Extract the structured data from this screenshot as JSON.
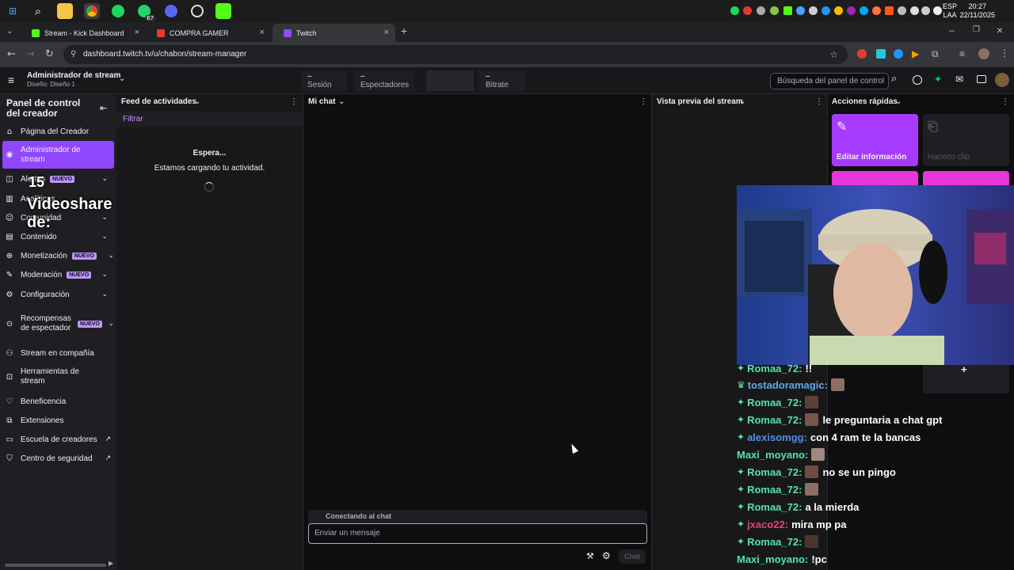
{
  "browser": {
    "tabs": [
      {
        "label": "Stream - Kick Dashboard",
        "favicon_color": "#53fc18"
      },
      {
        "label": "COMPRA GAMER",
        "favicon_color": "#e53935"
      },
      {
        "label": "Twitch",
        "favicon_color": "#9147ff"
      }
    ],
    "url": "dashboard.twitch.tv/u/chabon/stream-manager",
    "new_tab_glyph": "+"
  },
  "system": {
    "lang_line1": "ESP",
    "lang_line2": "LAA",
    "time": "20:27",
    "date": "22/11/2025",
    "whatsapp_count": "67"
  },
  "header": {
    "title": "Administrador de stream",
    "subtitle": "Diseño: Diseño 1",
    "stats": [
      {
        "value": "–",
        "label": "Sesión"
      },
      {
        "value": "–",
        "label": "Espectadores"
      },
      {
        "value": "",
        "label": ""
      },
      {
        "value": "–",
        "label": "Bitrate"
      }
    ],
    "search_placeholder": "Búsqueda del panel de control"
  },
  "sidebar": {
    "title": "Panel de control del creador",
    "items": [
      {
        "label": "Página del Creador",
        "icon": "home-icon"
      },
      {
        "label": "Administrador de stream",
        "icon": "broadcast-icon",
        "active": true
      },
      {
        "label": "Alertas",
        "icon": "alert-icon",
        "badge": "NUEVO"
      },
      {
        "label": "Analíticas",
        "icon": "analytics-icon"
      },
      {
        "label": "Comunidad",
        "icon": "community-icon"
      },
      {
        "label": "Contenido",
        "icon": "content-icon"
      },
      {
        "label": "Monetización",
        "icon": "money-icon",
        "badge": "NUEVO"
      },
      {
        "label": "Moderación",
        "icon": "mod-icon",
        "badge": "NUEVO"
      },
      {
        "label": "Configuración",
        "icon": "gear-icon"
      },
      {
        "label": "Recompensas de espectador",
        "icon": "reward-icon",
        "badge": "NUEVO"
      },
      {
        "label": "Stream en compañía",
        "icon": "collab-icon"
      },
      {
        "label": "Herramientas de stream",
        "icon": "tools-icon"
      },
      {
        "label": "Beneficencia",
        "icon": "charity-icon"
      },
      {
        "label": "Extensiones",
        "icon": "extension-icon"
      },
      {
        "label": "Escuela de creadores",
        "icon": "school-icon"
      },
      {
        "label": "Centro de seguridad",
        "icon": "shield-icon"
      }
    ],
    "overlay_number": "15",
    "overlay_text": "Videoshare de:"
  },
  "activity": {
    "title": "Feed de actividades",
    "filter": "Filtrar",
    "loading_title": "Espera...",
    "loading_text": "Estamos cargando tu actividad."
  },
  "chat": {
    "title": "Mi chat",
    "connecting": "Conectando al chat",
    "input_placeholder": "Enviar un mensaje",
    "send_label": "Chat"
  },
  "preview": {
    "title": "Vista previa del stream"
  },
  "quick_actions": {
    "title": "Acciones rápidas",
    "tiles": [
      {
        "label": "Editar información"
      },
      {
        "label": "Hacerto clip"
      }
    ],
    "add_glyph": "+"
  },
  "overlay_chat": [
    {
      "name": "Romaa_72:",
      "name_color": "#54e3a6",
      "msg": "!!",
      "badge": "✦"
    },
    {
      "name": "tostadoramagic:",
      "name_color": "#5fa8e8",
      "msg": "",
      "badge": "♛"
    },
    {
      "name": "Romaa_72:",
      "name_color": "#54e3a6",
      "msg": "",
      "badge": "✦"
    },
    {
      "name": "Romaa_72:",
      "name_color": "#54e3a6",
      "msg": "le preguntaria a chat gpt",
      "badge": "✦"
    },
    {
      "name": "alexisomgg:",
      "name_color": "#4f8fe0",
      "msg": "con 4 ram te la bancas",
      "badge": "✦"
    },
    {
      "name": "Maxi_moyano:",
      "name_color": "#54e3a6",
      "msg": "",
      "badge": ""
    },
    {
      "name": "Romaa_72:",
      "name_color": "#54e3a6",
      "msg": "no se un pingo",
      "badge": "✦"
    },
    {
      "name": "Romaa_72:",
      "name_color": "#54e3a6",
      "msg": "",
      "badge": "✦"
    },
    {
      "name": "Romaa_72:",
      "name_color": "#54e3a6",
      "msg": "a la mierda",
      "badge": "✦"
    },
    {
      "name": "jxaco22:",
      "name_color": "#e0457b",
      "msg": "mira mp pa",
      "badge": "✦"
    },
    {
      "name": "Romaa_72:",
      "name_color": "#54e3a6",
      "msg": "",
      "badge": "✦"
    },
    {
      "name": "Maxi_moyano:",
      "name_color": "#54e3a6",
      "msg": "!pc",
      "badge": ""
    }
  ],
  "colors": {
    "accent": "#9147ff",
    "accent_bright": "#a970ff",
    "tile_purple": "#a63bff",
    "tile_pink": "#e536d7"
  }
}
